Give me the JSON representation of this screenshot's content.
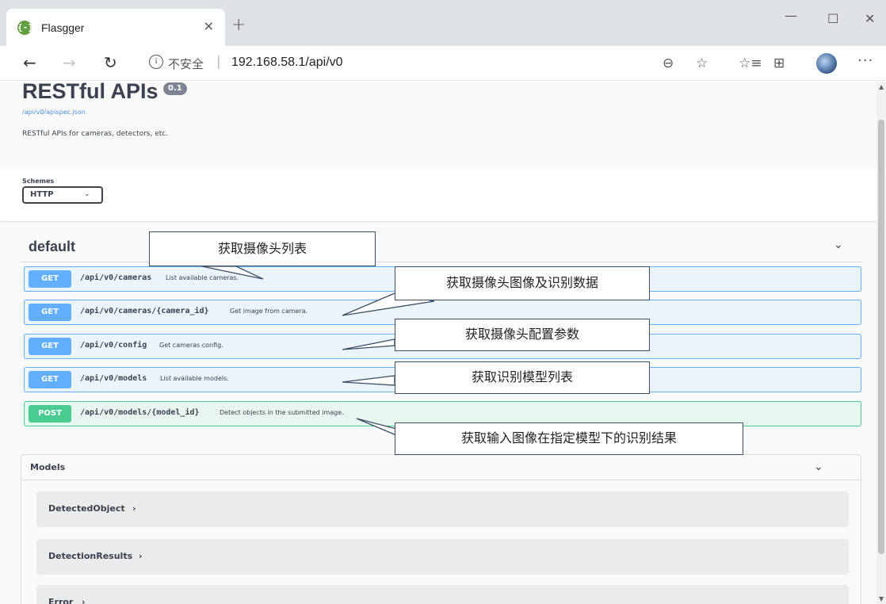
{
  "browser": {
    "tab_title": "Flasgger",
    "tab_icon": "{-}",
    "tab_close": "×",
    "new_tab": "+",
    "window_min": "—",
    "window_max": "☐",
    "window_close": "✕",
    "back": "←",
    "forward": "→",
    "refresh": "↻",
    "security_icon": "i",
    "security_label": "不安全",
    "url_separator": "|",
    "url": "192.168.58.1/api/v0",
    "zoom_icon": "⊖",
    "star_icon": "☆",
    "favorites_icon": "☆≡",
    "collections_icon": "⊞",
    "more": "···"
  },
  "info": {
    "title": "RESTful APIs",
    "version": "0.1",
    "spec_link": "/api/v0/apispec.json",
    "description": "RESTful APIs for cameras, detectors, etc."
  },
  "schemes": {
    "label": "Schemes",
    "selected": "HTTP",
    "caret": "⌄"
  },
  "section": {
    "title": "default",
    "chevron": "⌄"
  },
  "operations": [
    {
      "method": "GET",
      "path": "/api/v0/cameras",
      "summary": "List available cameras."
    },
    {
      "method": "GET",
      "path": "/api/v0/cameras/{camera_id}",
      "summary": "Get image from camera."
    },
    {
      "method": "GET",
      "path": "/api/v0/config",
      "summary": "Get cameras config."
    },
    {
      "method": "GET",
      "path": "/api/v0/models",
      "summary": "List available models."
    },
    {
      "method": "POST",
      "path": "/api/v0/models/{model_id}",
      "summary": "Detect objects in the submitted image."
    }
  ],
  "models": {
    "title": "Models",
    "chevron": "⌄",
    "items": [
      {
        "name": "DetectedObject",
        "caret": "›"
      },
      {
        "name": "DetectionResults",
        "caret": "›"
      },
      {
        "name": "Error",
        "caret": "›"
      }
    ]
  },
  "callouts": [
    "获取摄像头列表",
    "获取摄像头图像及识别数据",
    "获取摄像头配置参数",
    "获取识别模型列表",
    "获取输入图像在指定模型下的识别结果"
  ],
  "colors": {
    "get": "#61affe",
    "post": "#49cc90",
    "callout_border": "#3a4f66"
  }
}
